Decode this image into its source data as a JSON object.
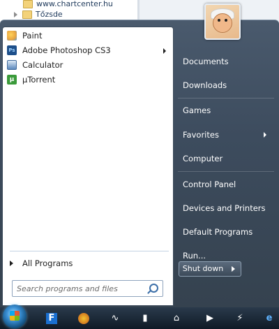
{
  "background_window": {
    "url_row": "www.chartcenter.hu",
    "folder_row": "Tőzsde"
  },
  "left_pane": {
    "programs": [
      {
        "label": "Paint",
        "icon": "paint-icon",
        "has_submenu": false,
        "color": "#e8a440"
      },
      {
        "label": "Adobe Photoshop CS3",
        "icon": "photoshop-icon",
        "has_submenu": true,
        "color": "#1d4f8a"
      },
      {
        "label": "Calculator",
        "icon": "calculator-icon",
        "has_submenu": false,
        "color": "#5a88bd"
      },
      {
        "label": "µTorrent",
        "icon": "utorrent-icon",
        "has_submenu": false,
        "color": "#3a9a3a"
      }
    ],
    "all_programs_label": "All Programs",
    "search_placeholder": "Search programs and files"
  },
  "right_pane": {
    "items": [
      {
        "label": "Documents",
        "has_submenu": false
      },
      {
        "label": "Downloads",
        "has_submenu": false
      },
      {
        "label": "Games",
        "has_submenu": false
      },
      {
        "label": "Favorites",
        "has_submenu": true
      },
      {
        "label": "Computer",
        "has_submenu": false
      },
      {
        "label": "Control Panel",
        "has_submenu": false
      },
      {
        "label": "Devices and Printers",
        "has_submenu": false
      },
      {
        "label": "Default Programs",
        "has_submenu": false
      },
      {
        "label": "Run...",
        "has_submenu": false
      }
    ],
    "shutdown_label": "Shut down"
  },
  "taskbar": {
    "icons": [
      "start-orb-icon",
      "foobar-f-icon",
      "winamp-icon",
      "media-wave-icon",
      "equalizer-icon",
      "usb-icon",
      "window-switch-icon",
      "play-icon",
      "flash-icon",
      "ie-icon"
    ]
  }
}
